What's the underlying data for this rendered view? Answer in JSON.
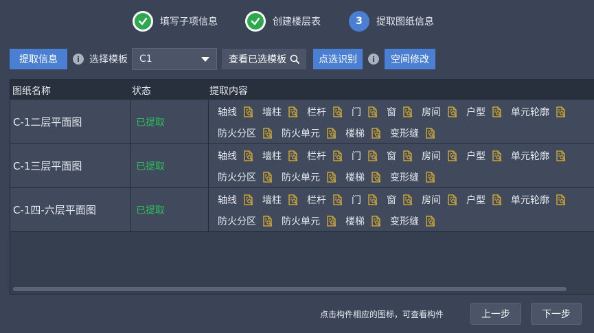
{
  "steps": [
    {
      "label": "填写子项信息",
      "state": "done"
    },
    {
      "label": "创建楼层表",
      "state": "done"
    },
    {
      "label": "提取图纸信息",
      "state": "current",
      "number": "3"
    }
  ],
  "toolbar": {
    "extract_label": "提取信息",
    "info_glyph": "i",
    "select_template_label": "选择模板",
    "template_value": "C1",
    "view_selected_label": "查看已选模板",
    "pick_identify_label": "点选识别",
    "space_edit_label": "空间修改"
  },
  "table": {
    "headers": [
      "图纸名称",
      "状态",
      "提取内容"
    ],
    "rows": [
      {
        "name": "C-1二层平面图",
        "status": "已提取"
      },
      {
        "name": "C-1三层平面图",
        "status": "已提取"
      },
      {
        "name": "C-1四-六层平面图",
        "status": "已提取"
      }
    ],
    "content_line1": [
      "轴线",
      "墙柱",
      "栏杆",
      "门",
      "窗",
      "房间",
      "户型",
      "单元轮廓"
    ],
    "content_line2": [
      "防火分区",
      "防火单元",
      "楼梯",
      "变形缝"
    ]
  },
  "footer": {
    "hint": "点击构件相应的图标，可查看构件",
    "prev_label": "上一步",
    "next_label": "下一步"
  },
  "colors": {
    "accent": "#4a7fd4",
    "success": "#2fbf5b",
    "doc_icon": "#c9a535"
  }
}
